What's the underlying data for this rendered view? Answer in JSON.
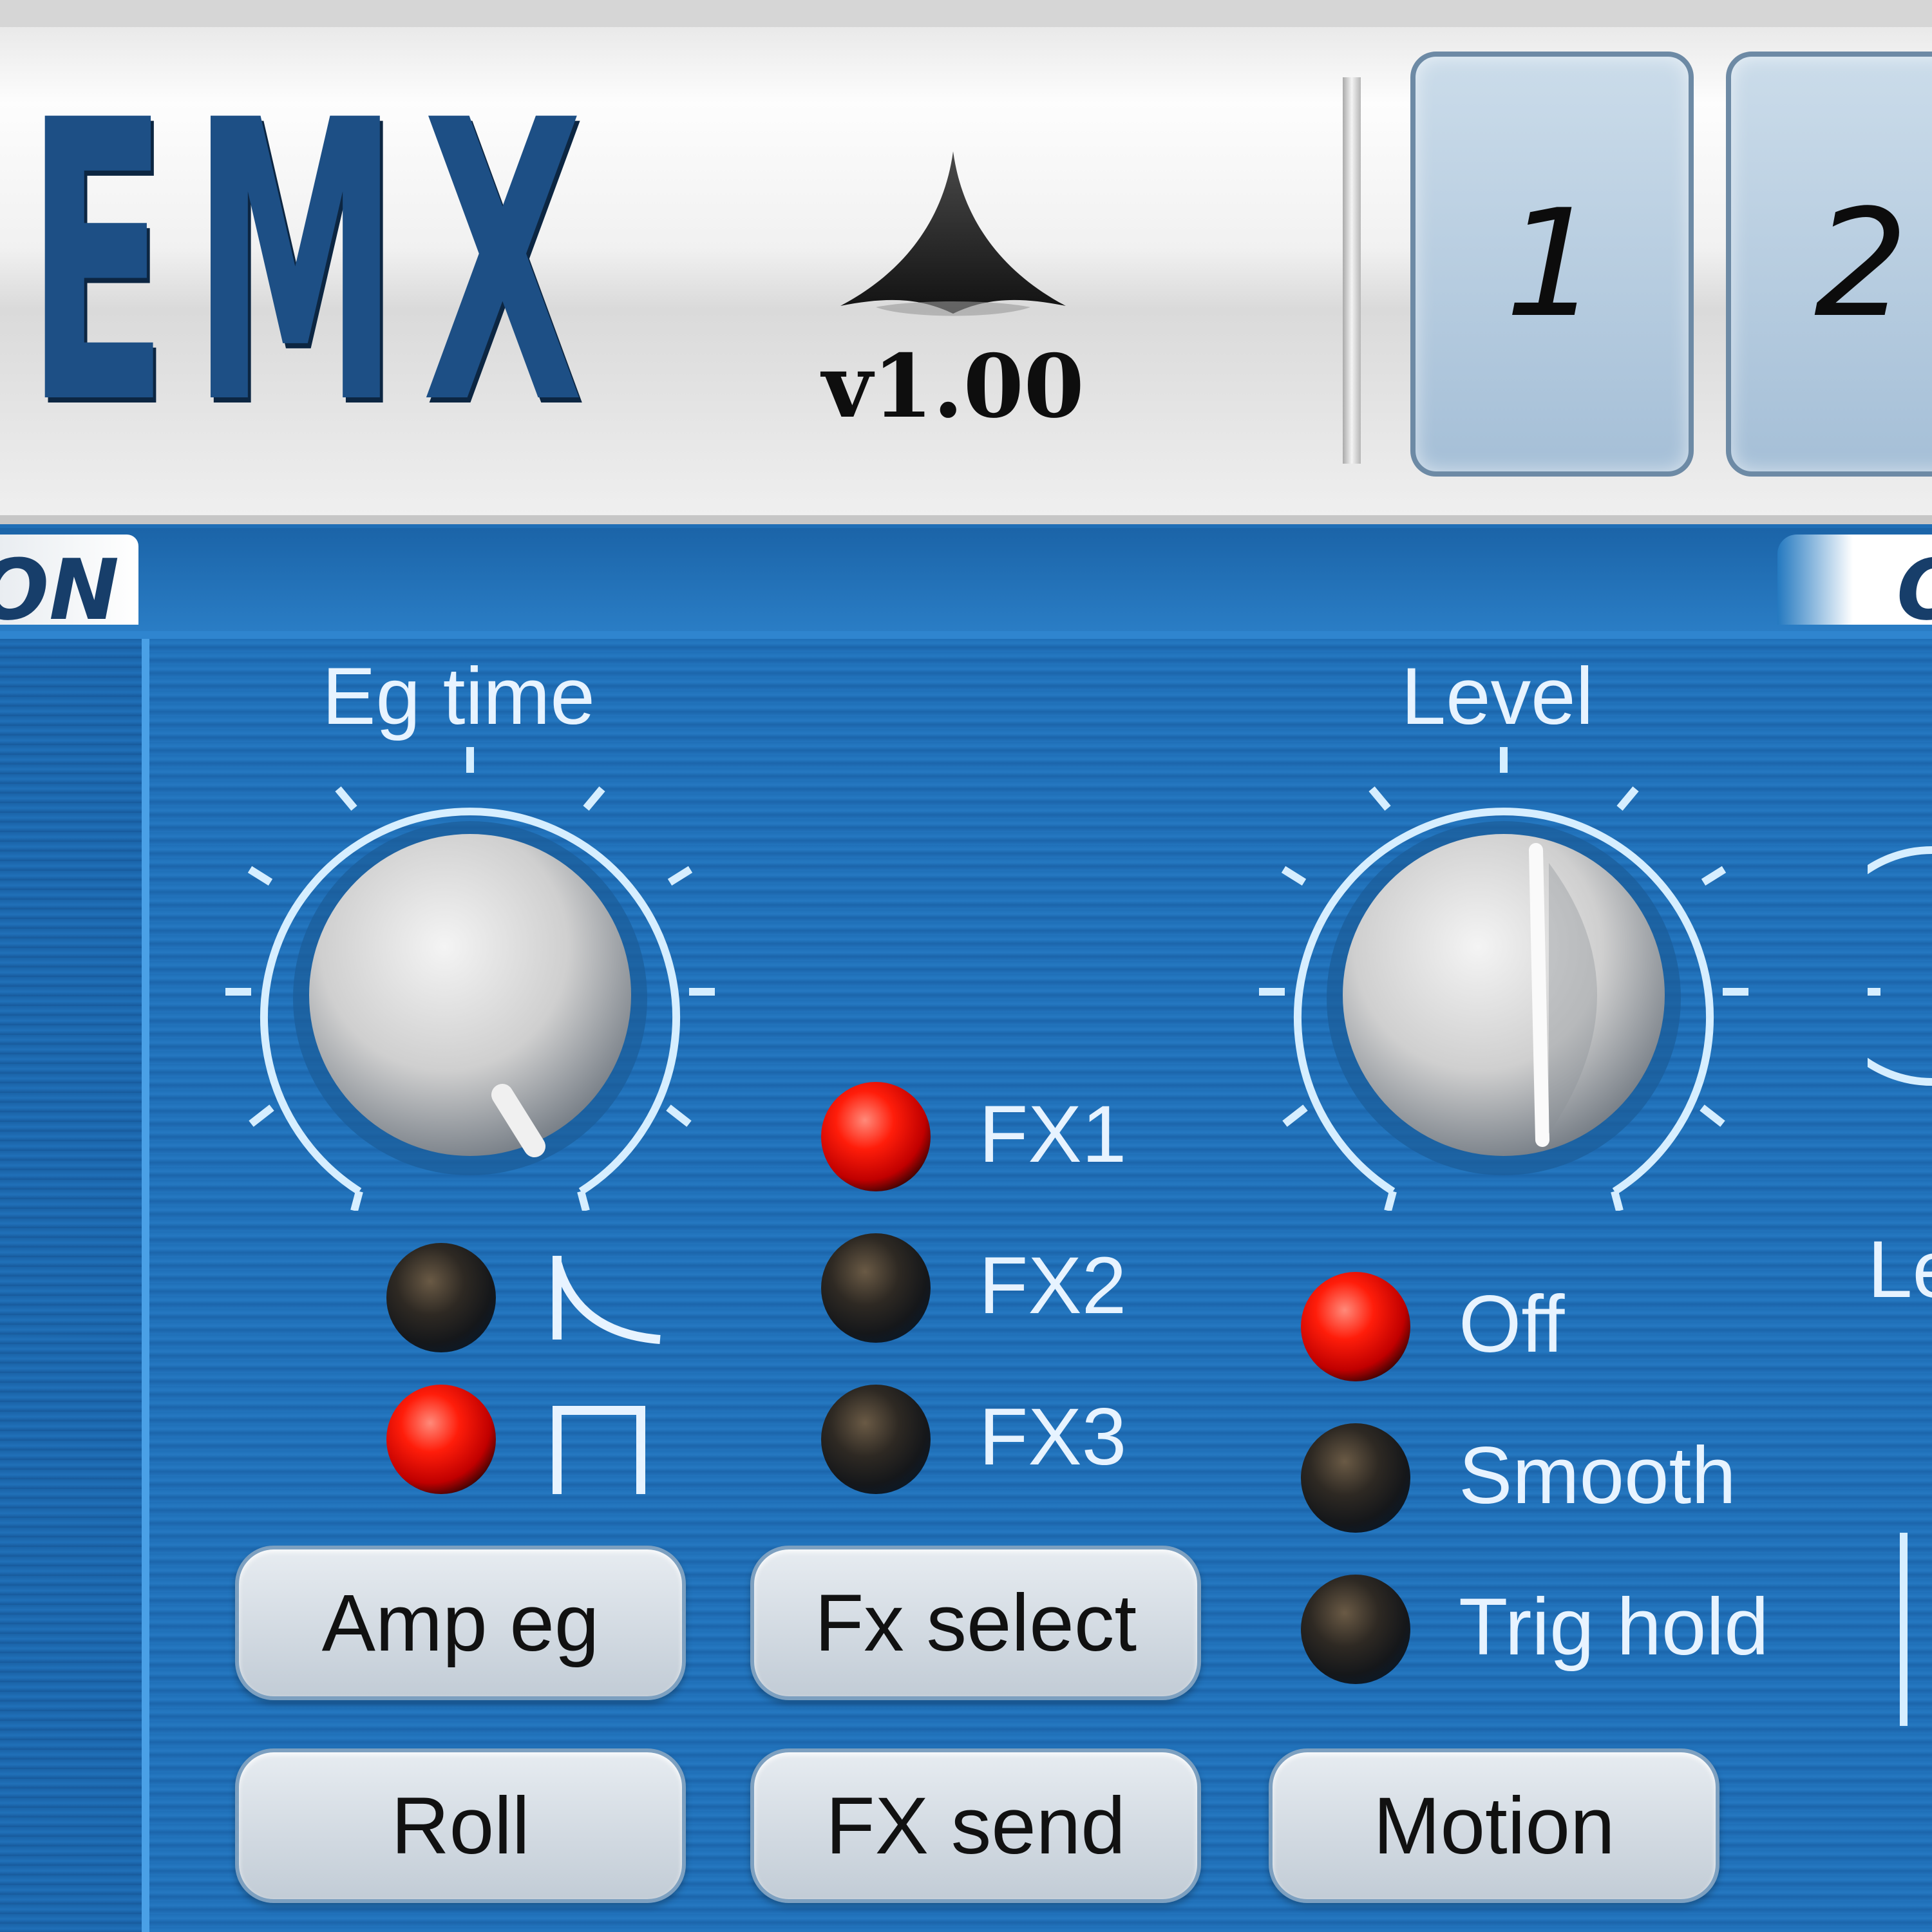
{
  "header": {
    "logo_text": "EMX",
    "version": "v1.00",
    "pads": [
      "1",
      "2"
    ]
  },
  "strip": {
    "left_tab_fragment": "ON",
    "right_tab_fragment": "O"
  },
  "panel": {
    "knobs": [
      {
        "label": "Eg time"
      },
      {
        "label": "Level"
      }
    ],
    "amp_eg_modes": [
      {
        "icon": "decay-curve-icon",
        "active": false
      },
      {
        "icon": "gate-shape-icon",
        "active": true
      }
    ],
    "fx_leds": [
      {
        "label": "FX1",
        "active": true
      },
      {
        "label": "FX2",
        "active": false
      },
      {
        "label": "FX3",
        "active": false
      }
    ],
    "motion_leds": [
      {
        "label": "Off",
        "active": true
      },
      {
        "label": "Smooth",
        "active": false
      },
      {
        "label": "Trig hold",
        "active": false
      }
    ],
    "right_fragment_label": "Le",
    "buttons": {
      "amp_eg": "Amp eg",
      "fx_select": "Fx select",
      "roll": "Roll",
      "fx_send": "FX send",
      "motion": "Motion"
    }
  },
  "colors": {
    "panel_blue": "#1f6eb6",
    "led_on": "#ff1d0a",
    "led_off": "#15171a",
    "logo_blue": "#1d4f85"
  }
}
